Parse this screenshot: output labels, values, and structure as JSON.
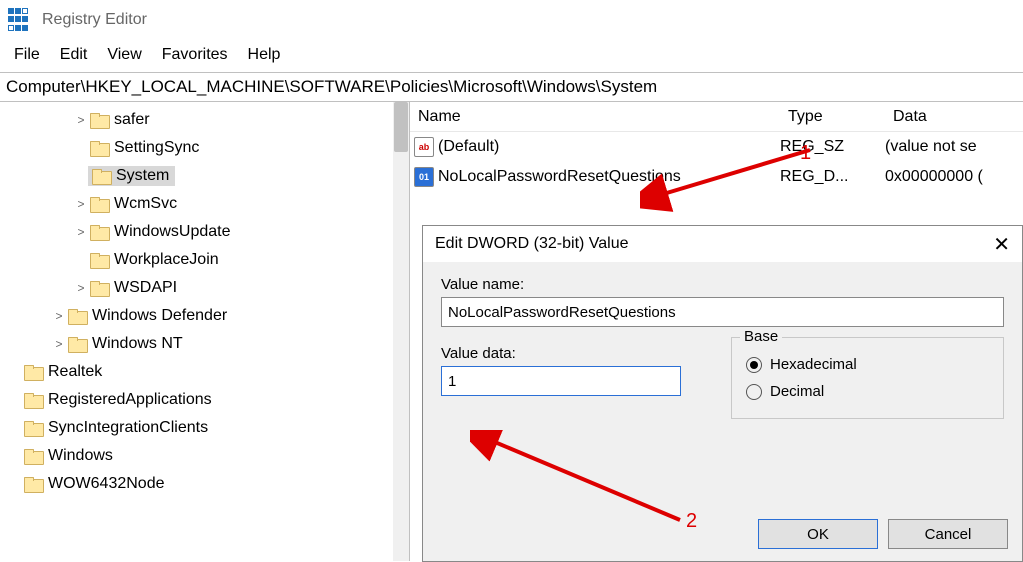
{
  "app": {
    "title": "Registry Editor"
  },
  "menu": {
    "items": [
      "File",
      "Edit",
      "View",
      "Favorites",
      "Help"
    ]
  },
  "address": "Computer\\HKEY_LOCAL_MACHINE\\SOFTWARE\\Policies\\Microsoft\\Windows\\System",
  "tree": [
    {
      "indent": 3,
      "exp": ">",
      "label": "safer"
    },
    {
      "indent": 3,
      "exp": "",
      "label": "SettingSync"
    },
    {
      "indent": 3,
      "exp": "",
      "label": "System",
      "selected": true
    },
    {
      "indent": 3,
      "exp": ">",
      "label": "WcmSvc"
    },
    {
      "indent": 3,
      "exp": ">",
      "label": "WindowsUpdate"
    },
    {
      "indent": 3,
      "exp": "",
      "label": "WorkplaceJoin"
    },
    {
      "indent": 3,
      "exp": ">",
      "label": "WSDAPI"
    },
    {
      "indent": 2,
      "exp": ">",
      "label": "Windows Defender"
    },
    {
      "indent": 2,
      "exp": ">",
      "label": "Windows NT"
    },
    {
      "indent": 0,
      "exp": "",
      "label": "Realtek"
    },
    {
      "indent": 0,
      "exp": "",
      "label": "RegisteredApplications"
    },
    {
      "indent": 0,
      "exp": "",
      "label": "SyncIntegrationClients"
    },
    {
      "indent": 0,
      "exp": "",
      "label": "Windows"
    },
    {
      "indent": 0,
      "exp": "",
      "label": "WOW6432Node"
    }
  ],
  "columns": {
    "name": "Name",
    "type": "Type",
    "data": "Data"
  },
  "values": [
    {
      "icon": "sz",
      "glyph": "ab",
      "name": "(Default)",
      "type": "REG_SZ",
      "data": "(value not se"
    },
    {
      "icon": "dw",
      "glyph": "011\n010",
      "name": "NoLocalPasswordResetQuestions",
      "type": "REG_D...",
      "data": "0x00000000 ("
    }
  ],
  "dialog": {
    "title": "Edit DWORD (32-bit) Value",
    "value_name_label": "Value name:",
    "value_name": "NoLocalPasswordResetQuestions",
    "value_data_label": "Value data:",
    "value_data": "1",
    "base_label": "Base",
    "hex_label": "Hexadecimal",
    "dec_label": "Decimal",
    "base_selected": "hex",
    "ok": "OK",
    "cancel": "Cancel"
  },
  "annotations": {
    "label1": "1",
    "label2": "2"
  }
}
